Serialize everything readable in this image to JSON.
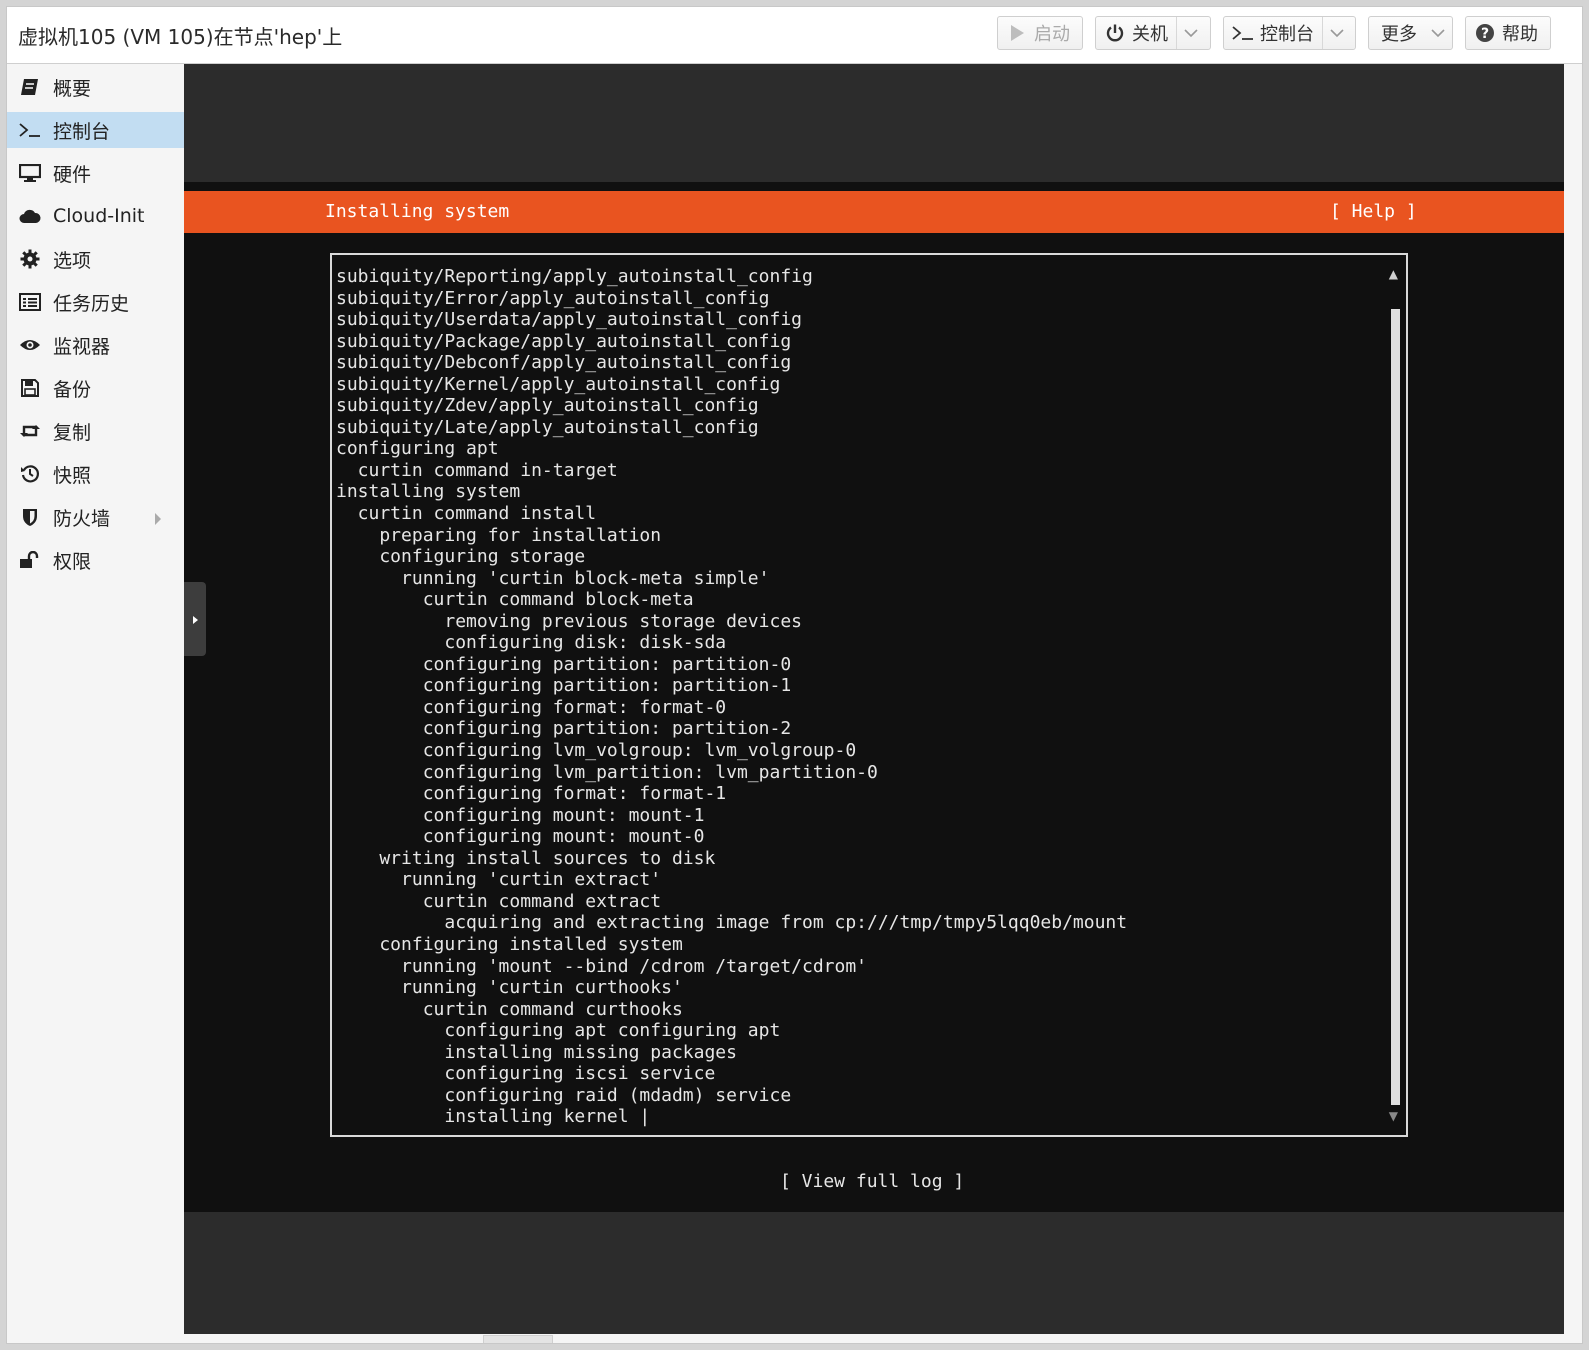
{
  "header": {
    "title": "虚拟机105 (VM 105)在节点'hep'上",
    "buttons": {
      "start": "启动",
      "shutdown": "关机",
      "console": "控制台",
      "more": "更多",
      "help": "帮助"
    }
  },
  "sidebar": {
    "items": [
      {
        "label": "概要",
        "icon": "book-icon"
      },
      {
        "label": "控制台",
        "icon": "terminal-icon",
        "active": true
      },
      {
        "label": "硬件",
        "icon": "monitor-icon"
      },
      {
        "label": "Cloud-Init",
        "icon": "cloud-icon"
      },
      {
        "label": "选项",
        "icon": "gear-icon"
      },
      {
        "label": "任务历史",
        "icon": "list-icon"
      },
      {
        "label": "监视器",
        "icon": "eye-icon"
      },
      {
        "label": "备份",
        "icon": "floppy-icon"
      },
      {
        "label": "复制",
        "icon": "retweet-icon"
      },
      {
        "label": "快照",
        "icon": "history-icon"
      },
      {
        "label": "防火墙",
        "icon": "shield-icon",
        "has_submenu": true
      },
      {
        "label": "权限",
        "icon": "unlock-icon"
      }
    ]
  },
  "console": {
    "bar_title": "Installing system",
    "help_label": "[ Help ]",
    "view_log_label": "[ View full log ]",
    "accent_color": "#e95420",
    "log_lines": [
      "subiquity/Reporting/apply_autoinstall_config",
      "subiquity/Error/apply_autoinstall_config",
      "subiquity/Userdata/apply_autoinstall_config",
      "subiquity/Package/apply_autoinstall_config",
      "subiquity/Debconf/apply_autoinstall_config",
      "subiquity/Kernel/apply_autoinstall_config",
      "subiquity/Zdev/apply_autoinstall_config",
      "subiquity/Late/apply_autoinstall_config",
      "configuring apt",
      "  curtin command in-target",
      "installing system",
      "  curtin command install",
      "    preparing for installation",
      "    configuring storage",
      "      running 'curtin block-meta simple'",
      "        curtin command block-meta",
      "          removing previous storage devices",
      "          configuring disk: disk-sda",
      "        configuring partition: partition-0",
      "        configuring partition: partition-1",
      "        configuring format: format-0",
      "        configuring partition: partition-2",
      "        configuring lvm_volgroup: lvm_volgroup-0",
      "        configuring lvm_partition: lvm_partition-0",
      "        configuring format: format-1",
      "        configuring mount: mount-1",
      "        configuring mount: mount-0",
      "    writing install sources to disk",
      "      running 'curtin extract'",
      "        curtin command extract",
      "          acquiring and extracting image from cp:///tmp/tmpy5lqq0eb/mount",
      "    configuring installed system",
      "      running 'mount --bind /cdrom /target/cdrom'",
      "      running 'curtin curthooks'",
      "        curtin command curthooks",
      "          configuring apt configuring apt",
      "          installing missing packages",
      "          configuring iscsi service",
      "          configuring raid (mdadm) service",
      "          installing kernel |"
    ]
  }
}
